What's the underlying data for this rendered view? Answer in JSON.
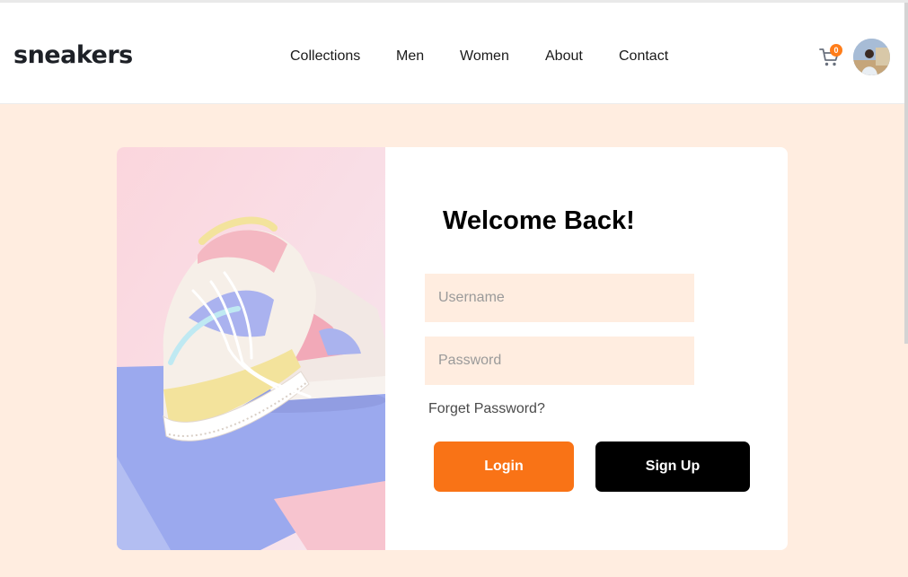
{
  "header": {
    "logo": "sneakers",
    "nav": [
      {
        "label": "Collections"
      },
      {
        "label": "Men"
      },
      {
        "label": "Women"
      },
      {
        "label": "About"
      },
      {
        "label": "Contact"
      }
    ],
    "cart_count": "0",
    "icons": {
      "cart": "cart-icon",
      "avatar": "user-avatar"
    }
  },
  "login": {
    "title": "Welcome Back!",
    "username_placeholder": "Username",
    "password_placeholder": "Password",
    "forgot_label": "Forget Password?",
    "login_label": "Login",
    "signup_label": "Sign Up"
  },
  "colors": {
    "accent": "#f97316",
    "background": "#ffede0",
    "dark": "#000000"
  }
}
